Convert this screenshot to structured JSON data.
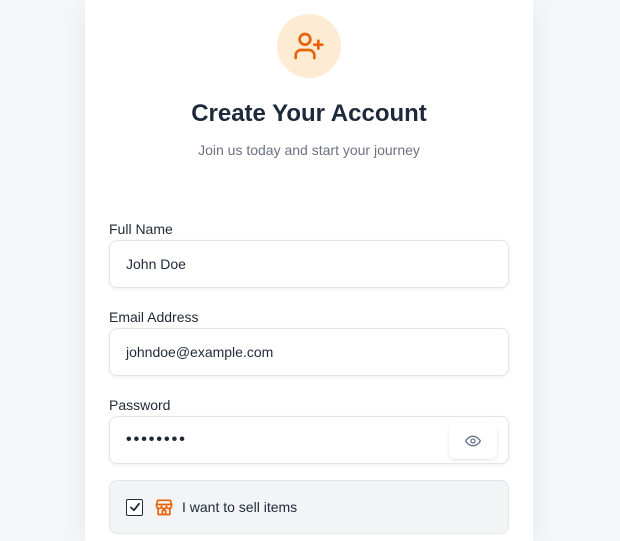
{
  "header": {
    "icon": "user-plus-icon",
    "title": "Create Your Account",
    "subtitle": "Join us today and start your journey"
  },
  "form": {
    "full_name": {
      "label": "Full Name",
      "value": "John Doe"
    },
    "email": {
      "label": "Email Address",
      "value": "johndoe@example.com"
    },
    "password": {
      "label": "Password",
      "value": "••••••••",
      "toggle_icon": "eye-icon"
    },
    "seller": {
      "label": "I want to sell items",
      "checked": true,
      "icon": "store-icon"
    }
  },
  "colors": {
    "accent": "#e8630a",
    "avatar_bg": "#fdebd3",
    "page_bg": "#f4f6f9"
  }
}
